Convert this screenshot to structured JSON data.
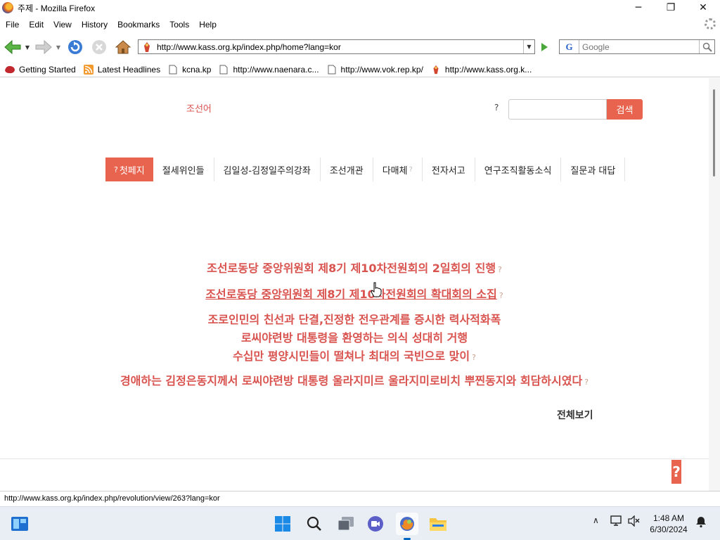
{
  "window": {
    "title": "주제 - Mozilla Firefox",
    "minimize_glyph": "─",
    "maximize_glyph": "❐",
    "close_glyph": "✕"
  },
  "menu": [
    "File",
    "Edit",
    "View",
    "History",
    "Bookmarks",
    "Tools",
    "Help"
  ],
  "navbar": {
    "url": "http://www.kass.org.kp/index.php/home?lang=kor",
    "search_placeholder": "Google",
    "search_engine_glyph": "G"
  },
  "bookmarks": [
    {
      "label": "Getting Started",
      "icon": "firefox-bookmark-icon"
    },
    {
      "label": "Latest Headlines",
      "icon": "rss-icon"
    },
    {
      "label": "kcna.kp",
      "icon": "page-icon"
    },
    {
      "label": "http://www.naenara.c...",
      "icon": "page-icon"
    },
    {
      "label": "http://www.vok.rep.kp/",
      "icon": "page-icon"
    },
    {
      "label": "http://www.kass.org.k...",
      "icon": "site-favicon"
    }
  ],
  "page": {
    "language_link": "조선어",
    "search_help": "?",
    "search_button": "검색",
    "nav": [
      {
        "label": "첫페지",
        "prefix": "?",
        "active": true
      },
      {
        "label": "절세위인들"
      },
      {
        "label": "김일성-김정일주의강좌"
      },
      {
        "label": "조선개관"
      },
      {
        "label": "다매체",
        "suffix": "?"
      },
      {
        "label": "전자서고"
      },
      {
        "label": "연구조직활동소식"
      },
      {
        "label": "질문과 대답"
      }
    ],
    "news": [
      {
        "text": "조선로동당 중앙위원회 제8기 제10차전원회의 2일회의 진행",
        "q": "?"
      },
      {
        "text": "조선로동당 중앙위원회 제8기 제10차전원회의 확대회의 소집",
        "q": "?",
        "underline": true
      },
      {
        "text": "조로인민의 친선과 단결,진정한 전우관계를 증시한 력사적화폭",
        "q": ""
      },
      {
        "text": "로씨야련방 대통령을 환영하는 의식 성대히 거행",
        "q": ""
      },
      {
        "text": "수십만 평양시민들이 떨쳐나 최대의 국빈으로 맞이",
        "q": "?"
      },
      {
        "text": "경애하는 김정은동지께서 로씨야련방 대통령 울라지미르 울라지미로비치 뿌찐동지와 회담하시였다",
        "q": "?"
      }
    ],
    "view_all": "전체보기",
    "to_top": "?"
  },
  "status_text": "http://www.kass.org.kp/index.php/revolution/view/263?lang=kor",
  "taskbar": {
    "time": "1:48 AM",
    "date": "6/30/2024",
    "tray_chevron": "∧"
  },
  "colors": {
    "accent": "#e8644f",
    "news_red": "#d9534f"
  }
}
